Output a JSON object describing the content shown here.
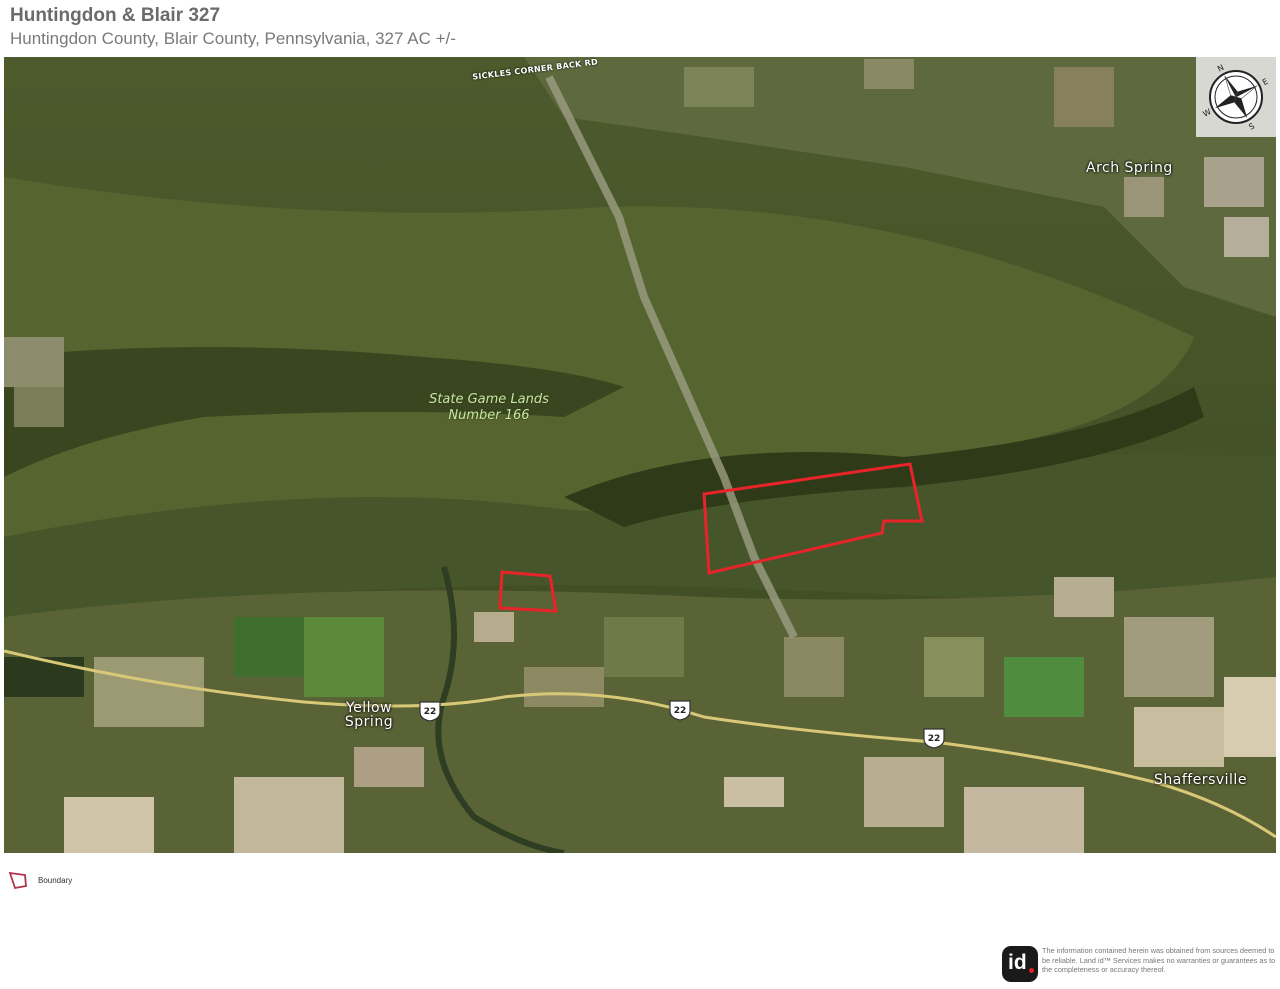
{
  "header": {
    "title": "Huntingdon & Blair 327",
    "subtitle": "Huntingdon County, Blair County, Pennsylvania, 327 AC +/-"
  },
  "map": {
    "labels": {
      "road_sickles": "SICKLES CORNER BACK RD",
      "arch_spring": "Arch Spring",
      "state_game_lands_line1": "State Game Lands",
      "state_game_lands_line2": "Number 166",
      "yellow_spring_line1": "Yellow",
      "yellow_spring_line2": "Spring",
      "shaffersville": "Shaffersville",
      "route_shield": "22"
    },
    "compass": {
      "letters": [
        "N",
        "E",
        "S",
        "W"
      ]
    },
    "boundary_color": "#e8242a"
  },
  "legend": {
    "items": [
      {
        "label": "Boundary",
        "color": "#b0334a"
      }
    ]
  },
  "footer": {
    "logo_text": "id",
    "disclaimer": "The information contained herein was obtained from sources deemed to be reliable. Land id™ Services makes no warranties or guarantees as to the completeness or accuracy thereof."
  }
}
